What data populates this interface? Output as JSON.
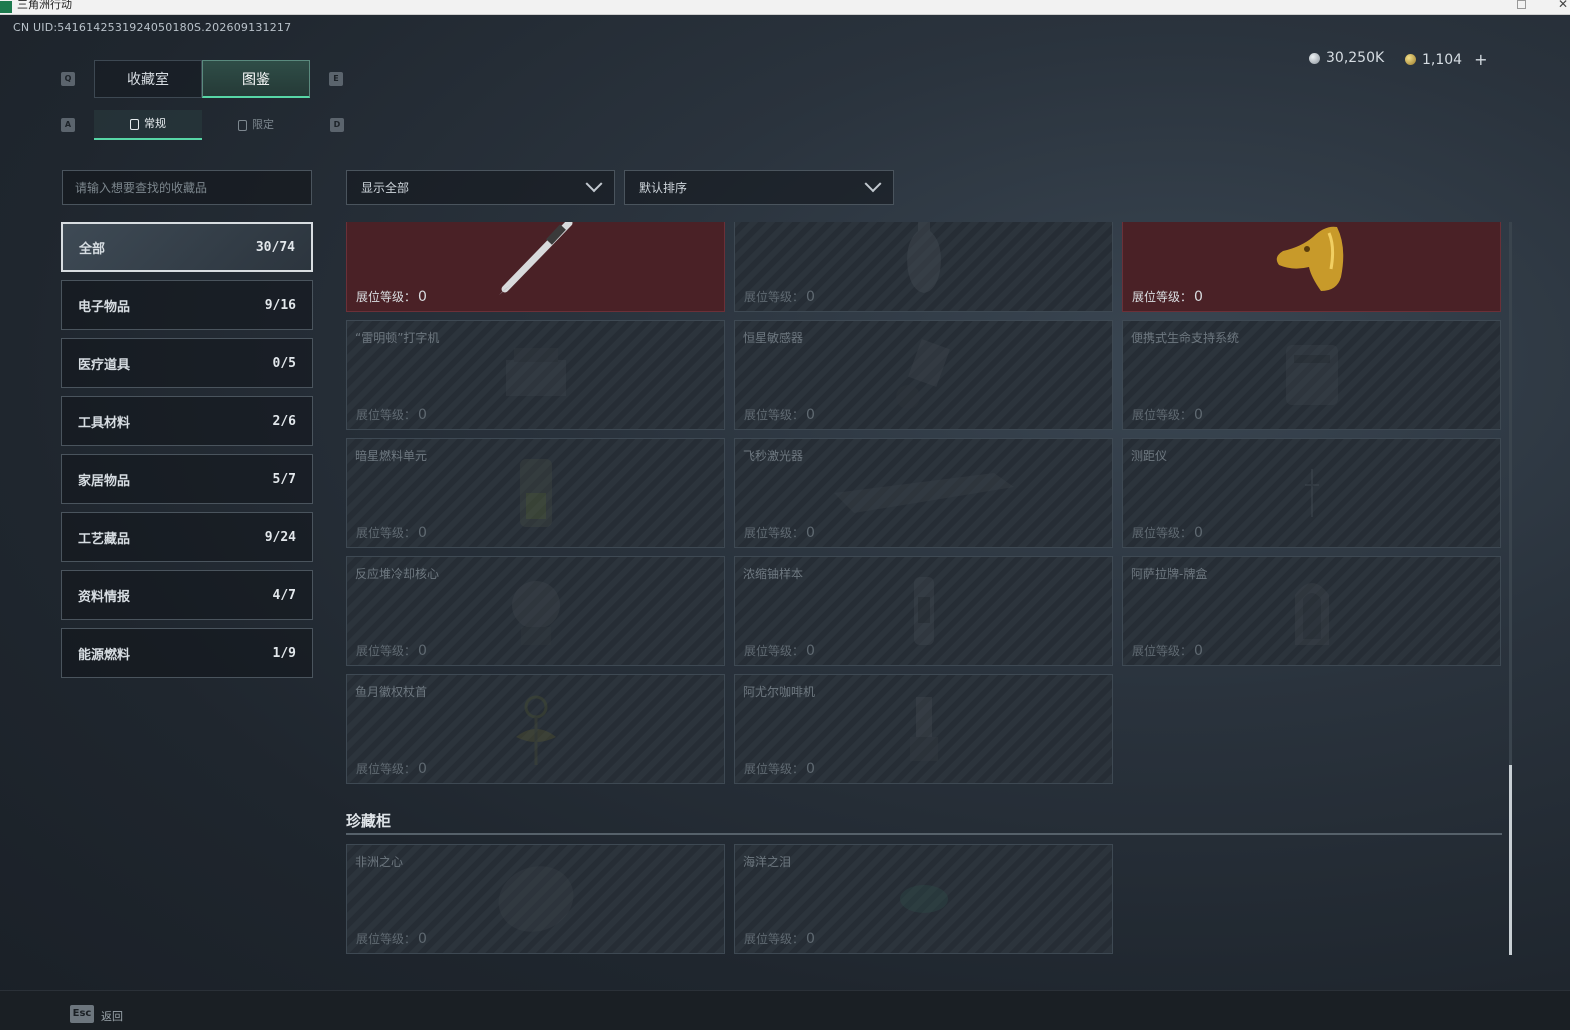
{
  "window": {
    "title": "三角洲行动"
  },
  "uid": "CN UID:5416142531924050180S.202609131217",
  "currency": {
    "silver": "30,250K",
    "gold": "1,104",
    "plus": "+"
  },
  "hotkeys": {
    "prev_main": "Q",
    "next_main": "E",
    "prev_sub": "A",
    "next_sub": "D",
    "back_key": "Esc"
  },
  "main_tabs": [
    {
      "label": "收藏室"
    },
    {
      "label": "图鉴"
    }
  ],
  "sub_tabs": [
    {
      "label": "常规"
    },
    {
      "label": "限定"
    }
  ],
  "search": {
    "placeholder": "请输入想要查找的收藏品"
  },
  "filters": {
    "show": "显示全部",
    "sort": "默认排序"
  },
  "categories": [
    {
      "label": "全部",
      "count": "30/74"
    },
    {
      "label": "电子物品",
      "count": "9/16"
    },
    {
      "label": "医疗道具",
      "count": "0/5"
    },
    {
      "label": "工具材料",
      "count": "2/6"
    },
    {
      "label": "家居物品",
      "count": "5/7"
    },
    {
      "label": "工艺藏品",
      "count": "9/24"
    },
    {
      "label": "资料情报",
      "count": "4/7"
    },
    {
      "label": "能源燃料",
      "count": "1/9"
    }
  ],
  "level_label": "展位等级：",
  "items": [
    {
      "name": "",
      "level": "0",
      "owned": true,
      "icon": "pen-icon"
    },
    {
      "name": "",
      "level": "0",
      "owned": false,
      "icon": "vase-icon"
    },
    {
      "name": "",
      "level": "0",
      "owned": true,
      "icon": "golden-horse-head-icon"
    },
    {
      "name": "“雷明顿”打字机",
      "level": "0",
      "owned": false,
      "icon": "typewriter-icon"
    },
    {
      "name": "恒星敏感器",
      "level": "0",
      "owned": false,
      "icon": "star-sensor-icon"
    },
    {
      "name": "便携式生命支持系统",
      "level": "0",
      "owned": false,
      "icon": "life-support-icon"
    },
    {
      "name": "暗星燃料单元",
      "level": "0",
      "owned": false,
      "icon": "fuel-cell-icon"
    },
    {
      "name": "飞秒激光器",
      "level": "0",
      "owned": false,
      "icon": "laser-icon"
    },
    {
      "name": "测距仪",
      "level": "0",
      "owned": false,
      "icon": "rangefinder-icon"
    },
    {
      "name": "反应堆冷却核心",
      "level": "0",
      "owned": false,
      "icon": "reactor-core-icon"
    },
    {
      "name": "浓缩铀样本",
      "level": "0",
      "owned": false,
      "icon": "uranium-sample-icon"
    },
    {
      "name": "阿萨拉牌-牌盒",
      "level": "0",
      "owned": false,
      "icon": "card-box-icon"
    },
    {
      "name": "鱼月徽权杖首",
      "level": "0",
      "owned": false,
      "icon": "scepter-head-icon"
    },
    {
      "name": "阿尤尔咖啡机",
      "level": "0",
      "owned": false,
      "icon": "coffee-machine-icon"
    }
  ],
  "cabinet": {
    "title": "珍藏柜",
    "items": [
      {
        "name": "非洲之心",
        "level": "0",
        "owned": false,
        "icon": "diamond-icon"
      },
      {
        "name": "海洋之泪",
        "level": "0",
        "owned": false,
        "icon": "gem-icon"
      }
    ]
  },
  "footer": {
    "back_label": "返回"
  }
}
